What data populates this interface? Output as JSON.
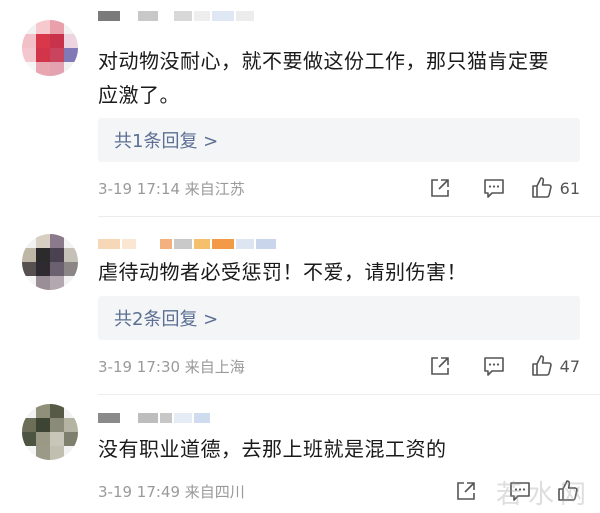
{
  "comments": [
    {
      "text_line1": "对动物没耐心，就不要做这份工作，那只猫肯定要",
      "text_line2": "应激了。",
      "reply_link": "共1条回复 >",
      "timestamp": "3-19 17:14 来自江苏",
      "like_count": "61",
      "avatar_icon": "blurred-avatar",
      "avatar_colors": [
        "#f2f2f2",
        "#f6c9cf",
        "#e9a0aa",
        "#f3f3f3",
        "#f2c1c8",
        "#d9384a",
        "#c8324a",
        "#ecd4e0",
        "#f3c7cd",
        "#d2344a",
        "#c9455e",
        "#7f79b5",
        "#f6f6f6",
        "#e8a6b0",
        "#e3a2b2",
        "#f1f1f1"
      ],
      "name_colors": [
        "#7b7b7b",
        "#ffffff",
        "#c8c8c8",
        "#ffffff",
        "#d8d8d8",
        "#eeeeee",
        "#dfe6f4",
        "#ececec"
      ]
    },
    {
      "text_line1": "虐待动物者必受惩罚！不爱，请别伤害！",
      "reply_link": "共2条回复 >",
      "timestamp": "3-19 17:30 来自上海",
      "like_count": "47",
      "avatar_icon": "blurred-avatar",
      "avatar_colors": [
        "#f2f2f2",
        "#d8cfc3",
        "#8b7a8b",
        "#f3f3f3",
        "#bfb7a6",
        "#2b2b2b",
        "#4a4250",
        "#c5c0b8",
        "#565050",
        "#2f2a30",
        "#6a6070",
        "#8c8586",
        "#f5f5f5",
        "#9a8e97",
        "#b3a8b0",
        "#f2f2f2"
      ],
      "name_colors": [
        "#f6d8b8",
        "#fbe6d3",
        "#ffffff",
        "#f2b17f",
        "#c9c9c9",
        "#f4c06b",
        "#f29a48",
        "#dde5f2",
        "#c9d5ea"
      ]
    },
    {
      "text_line1": "没有职业道德，去那上班就是混工资的",
      "timestamp": "3-19 17:49 来自四川",
      "avatar_icon": "blurred-avatar",
      "avatar_colors": [
        "#f2f2f2",
        "#8f8f7a",
        "#565a46",
        "#f3f3f3",
        "#6c6e58",
        "#3d4434",
        "#8a8b79",
        "#b5b3a2",
        "#4e5442",
        "#9a9985",
        "#c7c6b8",
        "#7e7f6d",
        "#f5f5f5",
        "#9b9a88",
        "#c1c0b0",
        "#f2f2f2"
      ],
      "name_colors": [
        "#8a8a8a",
        "#ffffff",
        "#bdbdbd",
        "#c7c7c7",
        "#e6ecf6",
        "#cfdbef"
      ]
    }
  ],
  "watermark": "若水网",
  "icons": {
    "share": "share-icon",
    "comment": "comment-icon",
    "like": "thumbs-up-icon"
  },
  "colors": {
    "reply_link": "#5b6f93",
    "reply_bg": "#f4f5f7",
    "timestamp": "#9a9a9a"
  }
}
